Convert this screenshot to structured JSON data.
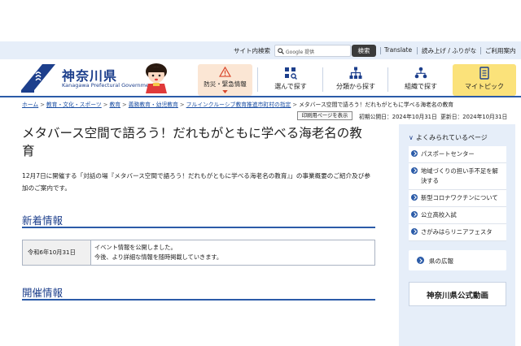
{
  "utility": {
    "site_search_label": "サイト内検索",
    "search_placeholder": "Google 提供",
    "search_button": "検索",
    "translate": "Translate",
    "read_aloud": "読み上げ / ふりがな",
    "user_guide": "ご利用案内"
  },
  "header": {
    "logo_jp": "神奈川県",
    "logo_en": "Kanagawa Prefectural Government",
    "logo_tag": "KANAGAWA",
    "disaster": "防災・緊急情報",
    "nav": [
      {
        "label": "選んで探す",
        "icon": "grid-search-icon"
      },
      {
        "label": "分類から探す",
        "icon": "category-tree-icon"
      },
      {
        "label": "組織で探す",
        "icon": "organization-icon"
      },
      {
        "label": "マイトピック",
        "icon": "bookmark-icon"
      }
    ]
  },
  "breadcrumb": {
    "items": [
      "ホーム",
      "教育・文化・スポーツ",
      "教育",
      "義務教育・幼児教育",
      "フルインクルーシブ教育推進市町村の指定"
    ],
    "current": "メタバース空間で語ろう！だれもがともに学べる海老名の教育"
  },
  "page": {
    "print_button": "印刷用ページを表示",
    "first_published": "初期公開日：2024年10月31日",
    "updated": "更新日：2024年10月31日",
    "title": "メタバース空間で語ろう！だれもがともに学べる海老名の教育",
    "intro": "12月7日に開催する「対話の場『メタバース空間で語ろう！だれもがともに学べる海老名の教育』」の事業概要のご紹介及び参加のご案内です。",
    "news_heading": "新着情報",
    "news": [
      {
        "date": "令和6年10月31日",
        "lines": [
          "イベント情報を公開しました。",
          "今後、より詳細な情報を随時掲載していきます。"
        ]
      }
    ],
    "event_heading": "開催情報"
  },
  "sidebar": {
    "heading": "よくみられているページ",
    "items": [
      "パスポートセンター",
      "地域づくりの担い手不足を解決する",
      "新型コロナワクチンについて",
      "公立高校入試",
      "さがみはらリニアフェスタ"
    ],
    "koho": "県の広報",
    "video": "神奈川県公式動画"
  },
  "colors": {
    "brand_blue": "#1d3f8c",
    "accent_blue": "#2b5ba8",
    "util_bg": "#e6eef9",
    "disaster_bg": "#fbe6d4",
    "mytopic_bg": "#fbe27a"
  }
}
